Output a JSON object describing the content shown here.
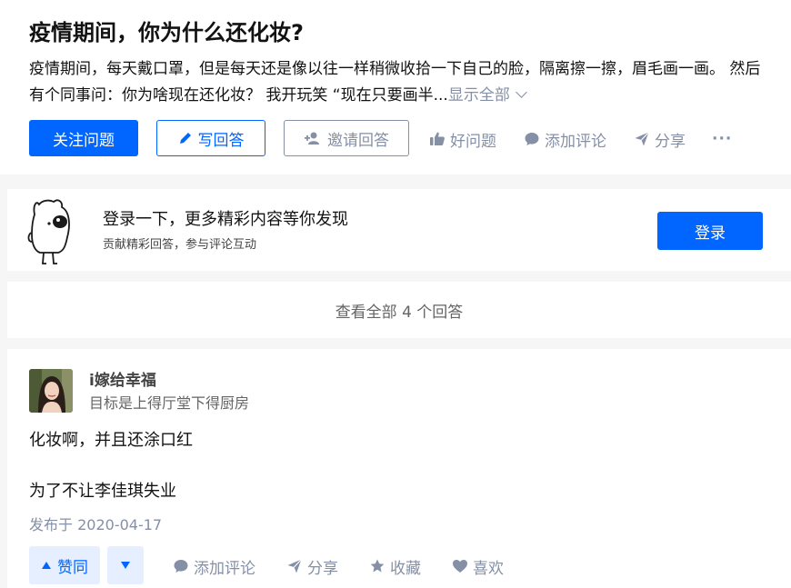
{
  "question": {
    "title": "疫情期间，你为什么还化妆?",
    "detail": "疫情期间，每天戴口罩，但是每天还是像以往一样稍微收拾一下自己的脸，隔离擦一擦，眉毛画一画。 然后有个同事问：你为啥现在还化妆？ 我开玩笑 “现在只要画半...",
    "show_all": "显示全部",
    "buttons": {
      "follow": "关注问题",
      "write": "写回答",
      "invite": "邀请回答"
    },
    "actions": {
      "good_question": "好问题",
      "comment": "添加评论",
      "share": "分享",
      "more": "···"
    }
  },
  "login_banner": {
    "title": "登录一下，更多精彩内容等你发现",
    "subtitle": "贡献精彩回答，参与评论互动",
    "button": "登录"
  },
  "view_all": "查看全部 4 个回答",
  "answer": {
    "author_name": "i嫁给幸福",
    "author_bio": "目标是上得厅堂下得厨房",
    "content": [
      "化妆啊，并且还涂口红",
      "为了不让李佳琪失业"
    ],
    "date": "发布于 2020-04-17",
    "vote_up": "赞同",
    "actions": {
      "comment": "添加评论",
      "share": "分享",
      "favorite": "收藏",
      "like": "喜欢"
    }
  },
  "colors": {
    "brand_blue": "#0066ff",
    "muted_gray": "#8590a6",
    "vote_bg": "#e5efff"
  }
}
